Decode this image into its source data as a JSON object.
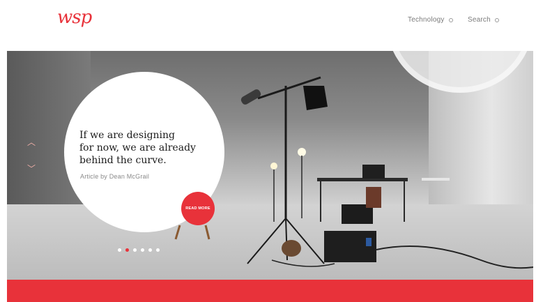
{
  "header": {
    "logo": "wsp",
    "nav": [
      {
        "label": "Technology",
        "icon": "circle-icon"
      },
      {
        "label": "Search",
        "icon": "circle-icon"
      }
    ]
  },
  "hero": {
    "quote_lines": [
      "If we are designing",
      "for now, we are already",
      "behind the curve."
    ],
    "author": "Article by Dean McGrail",
    "cta": "READ MORE",
    "carousel": {
      "count": 6,
      "active_index": 1
    },
    "arrows": {
      "up_icon": "chevron-up-icon",
      "down_icon": "chevron-down-icon"
    }
  },
  "colors": {
    "accent": "#e8323a",
    "text": "#1b1b1b",
    "muted": "#8a8a8a"
  }
}
